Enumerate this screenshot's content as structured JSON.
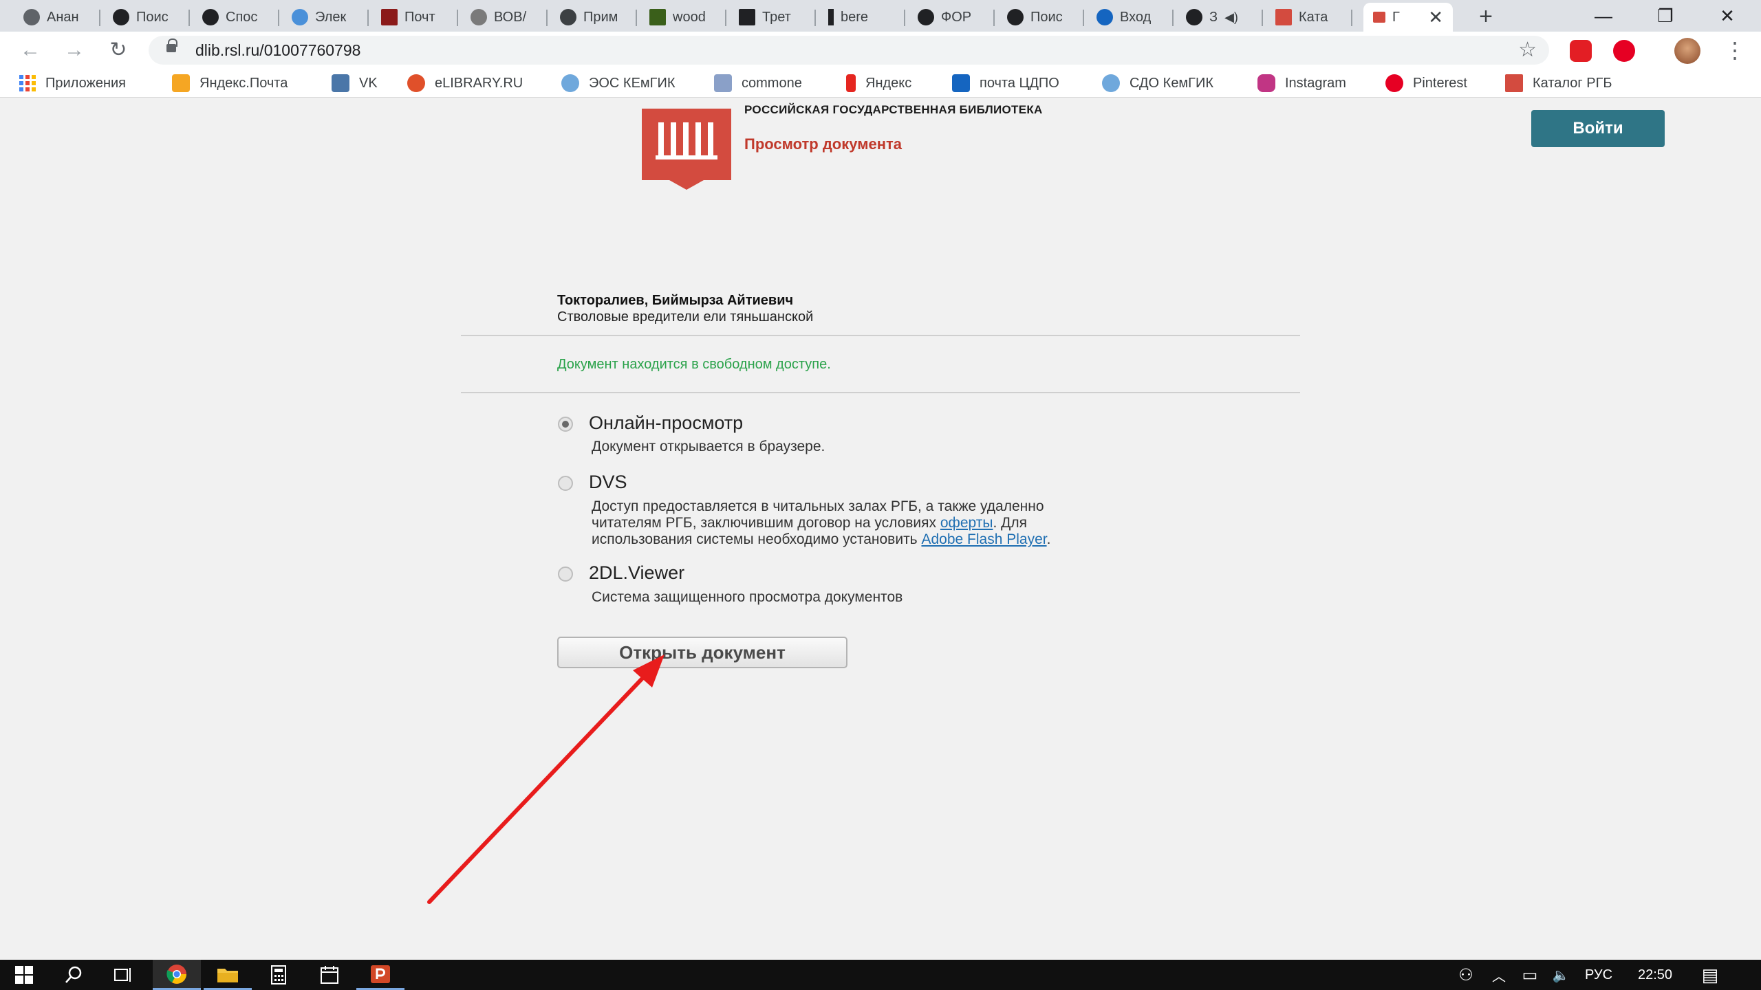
{
  "browser": {
    "tabs": [
      {
        "label": "Анан",
        "color": "#5f6368"
      },
      {
        "label": "Поис",
        "color": "#202124"
      },
      {
        "label": "Спос",
        "color": "#202124"
      },
      {
        "label": "Элек",
        "color": "#4a90d9"
      },
      {
        "label": "Почт",
        "color": "#8b1a1a"
      },
      {
        "label": "ВОВ/",
        "color": "#7a7a7a"
      },
      {
        "label": "Прим",
        "color": "#3c4043"
      },
      {
        "label": "wood",
        "color": "#3a5f1a"
      },
      {
        "label": "Трет",
        "color": "#202124"
      },
      {
        "label": "bere",
        "color": "#202124"
      },
      {
        "label": "ФОР",
        "color": "#202124"
      },
      {
        "label": "Поис",
        "color": "#202124"
      },
      {
        "label": "Вход",
        "color": "#1565c0"
      },
      {
        "label": "З",
        "color": "#202124"
      },
      {
        "label": "Ката",
        "color": "#d34b3f"
      },
      {
        "label": "Г",
        "color": "#d34b3f"
      }
    ],
    "active_tab_close": "✕",
    "new_tab_label": "+",
    "window_controls": {
      "minimize": "—",
      "restore": "❐",
      "close": "✕"
    },
    "nav": {
      "back": "←",
      "forward": "→",
      "reload": "↻"
    },
    "url": "dlib.rsl.ru/01007760798",
    "star": "☆",
    "menu": "⋮"
  },
  "bookmarks": [
    {
      "label": "Приложения",
      "icon": "apps-grid-icon",
      "color": "#4285f4"
    },
    {
      "label": "Яндекс.Почта",
      "icon": "mail-icon",
      "color": "#f5a623"
    },
    {
      "label": "VK",
      "icon": "vk-icon",
      "color": "#4a76a8"
    },
    {
      "label": "eLIBRARY.RU",
      "icon": "elibrary-icon",
      "color": "#e0502a"
    },
    {
      "label": "ЭОС КЕмГИК",
      "icon": "eos-icon",
      "color": "#6fa8dc"
    },
    {
      "label": "commone",
      "icon": "commone-icon",
      "color": "#8aa0c8"
    },
    {
      "label": "Яндекс",
      "icon": "yandex-icon",
      "color": "#e52620"
    },
    {
      "label": "почта ЦДПО",
      "icon": "mail-at-icon",
      "color": "#1565c0"
    },
    {
      "label": "СДО КемГИК",
      "icon": "sdo-icon",
      "color": "#6fa8dc"
    },
    {
      "label": "Instagram",
      "icon": "instagram-icon",
      "color": "#c13584"
    },
    {
      "label": "Pinterest",
      "icon": "pinterest-icon",
      "color": "#e60023"
    },
    {
      "label": "Каталог РГБ",
      "icon": "catalog-icon",
      "color": "#d34b3f"
    }
  ],
  "site": {
    "name": "РОССИЙСКАЯ ГОСУДАРСТВЕННАЯ БИБЛИОТЕКА",
    "subtitle": "Просмотр документа",
    "login_label": "Войти",
    "brand_color": "#d34b3f",
    "login_color": "#2f7586"
  },
  "document": {
    "author": "Токторалиев, Биймырза Айтиевич",
    "title": "Стволовые вредители ели тяньшанской",
    "status": "Документ находится в свободном доступе.",
    "status_color": "#2aa24a"
  },
  "options": [
    {
      "title": "Онлайн-просмотр",
      "checked": true,
      "desc_lines": [
        "Документ открывается в браузере."
      ]
    },
    {
      "title": "DVS",
      "checked": false,
      "desc": {
        "line1": "Доступ предоставляется в читальных залах РГБ, а также удаленно",
        "line2_pre": "читателям РГБ, заключившим договор на условиях ",
        "line2_link": "оферты",
        "line2_post": ". Для",
        "line3_pre": "использования системы необходимо установить ",
        "line3_link": "Adobe Flash Player",
        "line3_post": "."
      }
    },
    {
      "title": "2DL.Viewer",
      "checked": false,
      "desc_lines": [
        "Система защищенного просмотра документов"
      ]
    }
  ],
  "open_button_label": "Открыть документ",
  "annotation": {
    "arrow_color": "#e81c1c"
  },
  "taskbar": {
    "tray": {
      "lang": "РУС",
      "time": "22:50",
      "people": "⚇",
      "chevron": "︿",
      "network": "▭",
      "volume": "🔈",
      "notifications": "▤"
    }
  }
}
